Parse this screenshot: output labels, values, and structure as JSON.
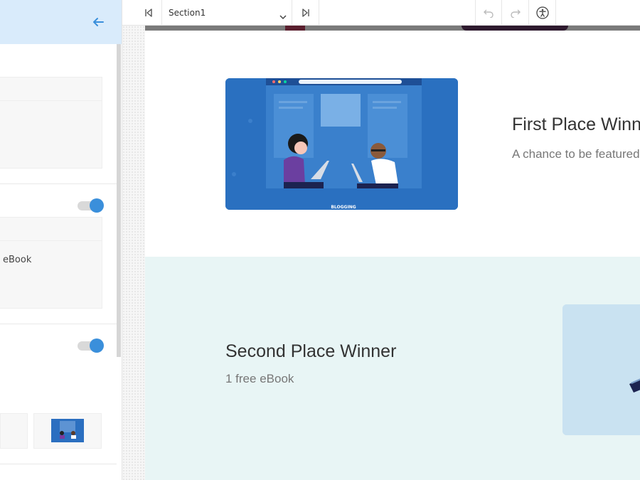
{
  "toolbar": {
    "section_select": "Section1",
    "icons": [
      "skip-back-icon",
      "chevron-down-icon",
      "skip-forward-icon",
      "undo-icon",
      "redo-icon",
      "accessibility-icon"
    ]
  },
  "left_panel": {
    "icons": [
      "arrow-left-icon"
    ],
    "ebook_text": "eBook",
    "toggles": [
      true,
      true
    ],
    "accent_color": "#3a8fdb",
    "header_color": "#d9ebfb"
  },
  "canvas": {
    "first": {
      "title": "First Place Winner",
      "subtitle": "A chance to be featured",
      "illustration_text": "BLOGGING"
    },
    "second": {
      "title": "Second Place Winner",
      "subtitle": "1 free eBook"
    },
    "colors": {
      "second_section_bg": "#e8f5f5",
      "illustration_blue": "#2a70c0"
    }
  }
}
